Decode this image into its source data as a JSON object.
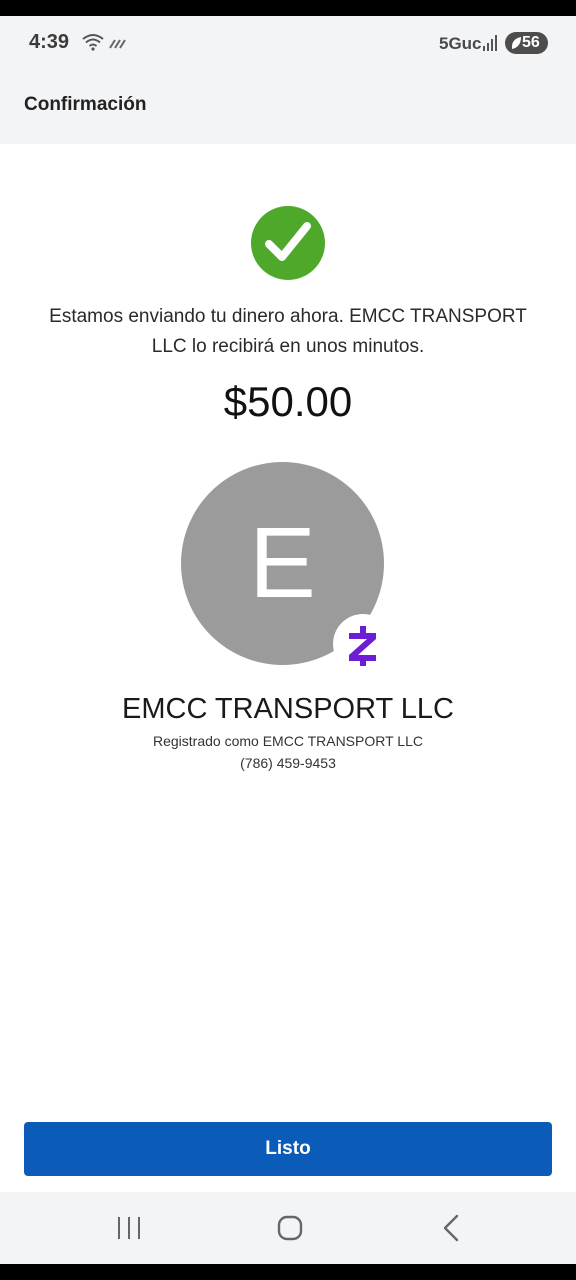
{
  "status_bar": {
    "time": "4:39",
    "network": "5Guc",
    "battery": "56"
  },
  "header": {
    "title": "Confirmación"
  },
  "confirmation": {
    "message": "Estamos enviando tu dinero ahora. EMCC TRANSPORT LLC lo recibirá en unos minutos.",
    "amount": "$50.00"
  },
  "recipient": {
    "initial": "E",
    "name": "EMCC TRANSPORT LLC",
    "registered_as": "Registrado como EMCC TRANSPORT LLC",
    "phone": "(786) 459-9453"
  },
  "actions": {
    "done_label": "Listo"
  },
  "icons": {
    "success": "check-circle-icon",
    "payment_network": "zelle-icon",
    "nav": [
      "recents-icon",
      "home-icon",
      "back-icon"
    ]
  },
  "colors": {
    "success_green": "#4ea82a",
    "primary_blue": "#0b5bb8",
    "zelle_purple": "#6d1ed4",
    "avatar_gray": "#9b9b9b"
  }
}
